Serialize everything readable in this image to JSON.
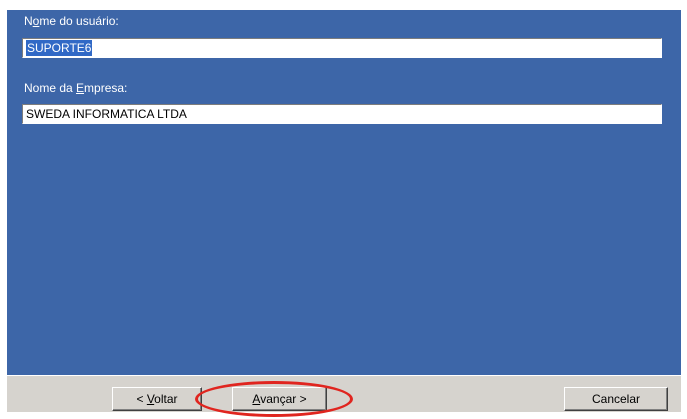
{
  "form": {
    "user_label_pre": "N",
    "user_label_accel": "o",
    "user_label_post": "me do usuário:",
    "user_value": "SUPORTE6",
    "company_label_pre": "Nome da ",
    "company_label_accel": "E",
    "company_label_post": "mpresa:",
    "company_value": "SWEDA INFORMATICA LTDA"
  },
  "buttons": {
    "back_pre": "< ",
    "back_accel": "V",
    "back_post": "oltar",
    "next_accel": "A",
    "next_post": "vançar >",
    "cancel": "Cancelar"
  },
  "colors": {
    "panel_background": "#3d66a8",
    "button_bar": "#d6d3ce",
    "highlight_circle": "#e0251f"
  }
}
